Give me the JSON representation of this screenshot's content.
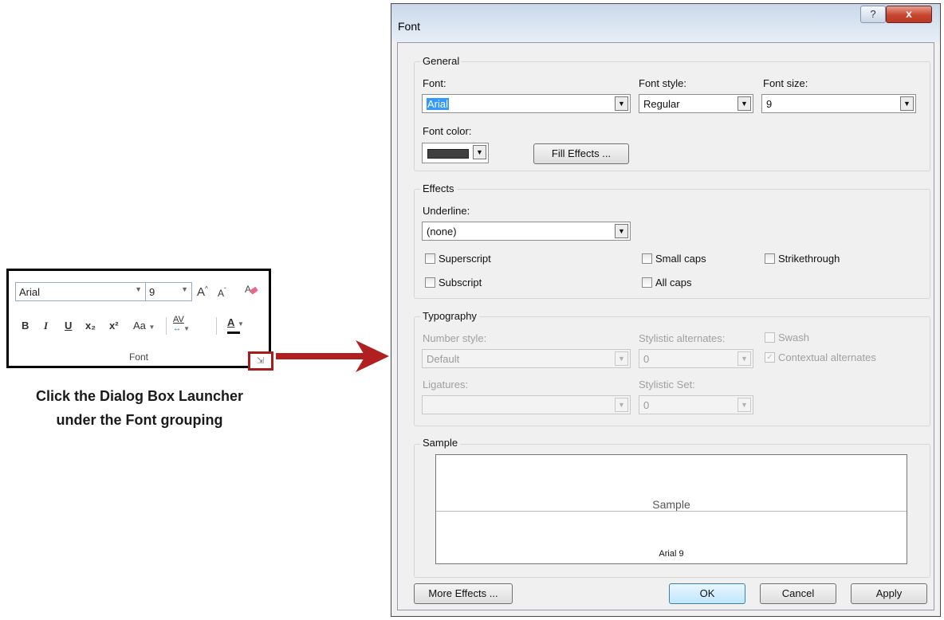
{
  "ribbon": {
    "font_name": "Arial",
    "font_size": "9",
    "group_label": "Font",
    "buttons": {
      "bold": "B",
      "italic": "I",
      "underline": "U",
      "subscript": "x₂",
      "superscript": "x²",
      "change_case": "Aa",
      "char_spacing": "AV",
      "font_color": "A",
      "grow": "A",
      "shrink": "A"
    },
    "launcher_icon": "dialog-launcher-icon"
  },
  "caption": {
    "line1": "Click the Dialog Box Launcher",
    "line2": "under the Font grouping"
  },
  "dialog": {
    "title": "Font",
    "help": "?",
    "close": "x",
    "general": {
      "heading": "General",
      "font_label": "Font:",
      "font_value": "Arial",
      "style_label": "Font style:",
      "style_value": "Regular",
      "size_label": "Font size:",
      "size_value": "9",
      "color_label": "Font color:",
      "color_value": "#404040",
      "fill_effects": "Fill Effects ..."
    },
    "effects": {
      "heading": "Effects",
      "underline_label": "Underline:",
      "underline_value": "(none)",
      "superscript": "Superscript",
      "subscript": "Subscript",
      "small_caps": "Small caps",
      "all_caps": "All caps",
      "strikethrough": "Strikethrough"
    },
    "typography": {
      "heading": "Typography",
      "number_style_label": "Number style:",
      "number_style_value": "Default",
      "stylistic_alt_label": "Stylistic alternates:",
      "stylistic_alt_value": "0",
      "swash": "Swash",
      "contextual": "Contextual alternates",
      "ligatures_label": "Ligatures:",
      "ligatures_value": "",
      "stylistic_set_label": "Stylistic Set:",
      "stylistic_set_value": "0"
    },
    "sample": {
      "heading": "Sample",
      "text": "Sample",
      "caption": "Arial 9"
    },
    "buttons": {
      "more_effects": "More Effects ...",
      "ok": "OK",
      "cancel": "Cancel",
      "apply": "Apply"
    }
  },
  "colors": {
    "highlight_red": "#a51d1d",
    "selection_blue": "#3399ff"
  }
}
